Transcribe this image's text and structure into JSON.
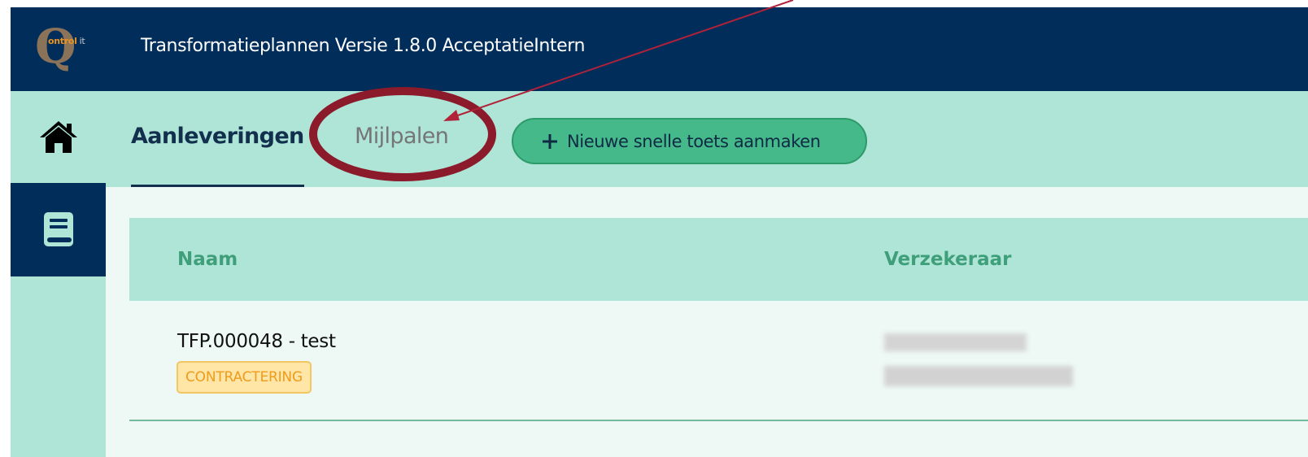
{
  "header": {
    "logo_letter": "Q",
    "logo_text": "ontrol",
    "logo_suffix": "it",
    "title": "Transformatieplannen Versie 1.8.0 AcceptatieIntern"
  },
  "sidebar": {
    "items": [
      {
        "icon": "home-icon"
      },
      {
        "icon": "book-icon"
      }
    ]
  },
  "tabs": {
    "active_label": "Aanleveringen",
    "other_label": "Mijlpalen",
    "new_button_label": "Nieuwe snelle toets aanmaken"
  },
  "table": {
    "columns": [
      "Naam",
      "Verzekeraar"
    ],
    "rows": [
      {
        "name": "TFP.000048 - test",
        "status": "CONTRACTERING"
      }
    ]
  },
  "colors": {
    "header_bg": "#002d5a",
    "mint_bg": "#aee5d6",
    "button_green": "#45b98a",
    "badge_bg": "#ffe6a6",
    "badge_text": "#ef9b1c",
    "annotation_red": "#8b1a2a"
  }
}
